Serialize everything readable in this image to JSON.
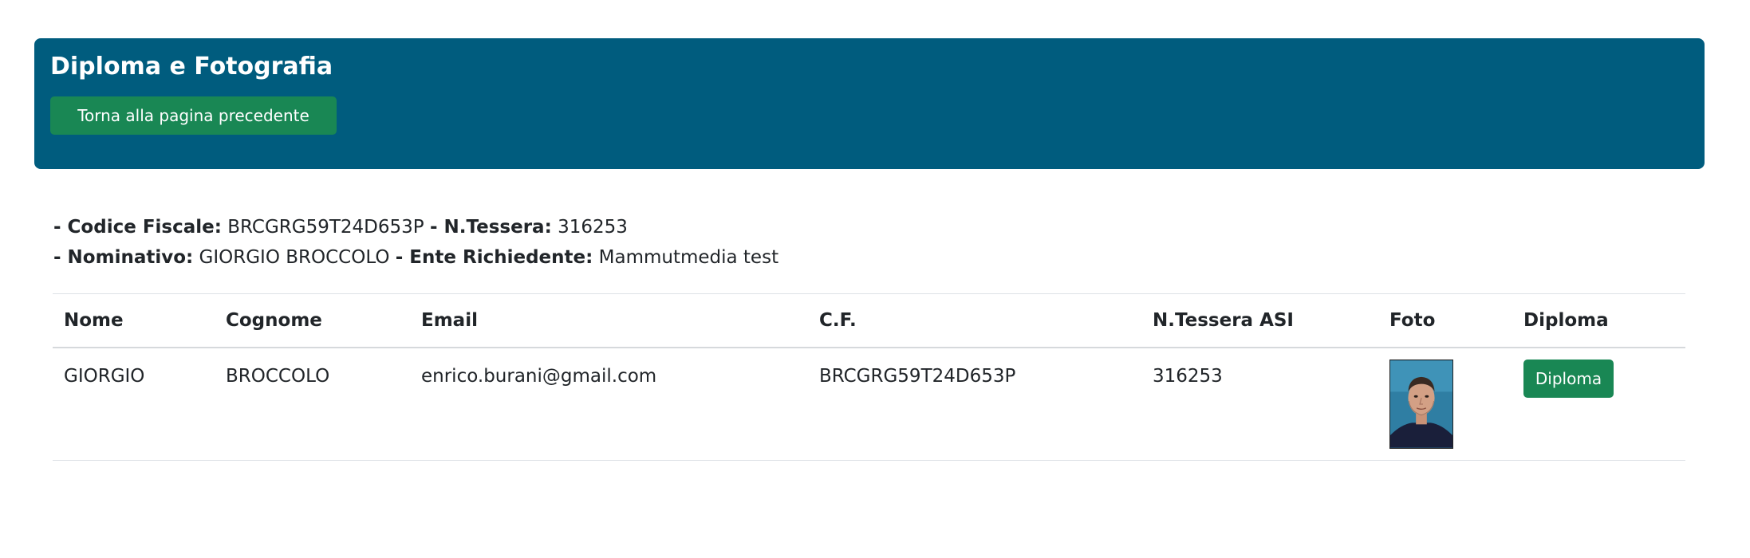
{
  "header": {
    "title": "Diploma e Fotografia",
    "back_button": "Torna alla pagina precedente"
  },
  "info": {
    "cf_label": "- Codice Fiscale:",
    "cf_value": "BRCGRG59T24D653P",
    "tessera_label": "- N.Tessera:",
    "tessera_value": "316253",
    "nominativo_label": "- Nominativo:",
    "nominativo_value": "GIORGIO BROCCOLO",
    "ente_label": "- Ente Richiedente:",
    "ente_value": "Mammutmedia test"
  },
  "table": {
    "headers": [
      "Nome",
      "Cognome",
      "Email",
      "C.F.",
      "N.Tessera ASI",
      "Foto",
      "Diploma"
    ],
    "rows": [
      {
        "nome": "GIORGIO",
        "cognome": "BROCCOLO",
        "email": "enrico.burani@gmail.com",
        "cf": "BRCGRG59T24D653P",
        "tessera": "316253",
        "diploma_button": "Diploma"
      }
    ]
  },
  "colors": {
    "header_bg": "#005c7e",
    "button_green": "#198754"
  }
}
